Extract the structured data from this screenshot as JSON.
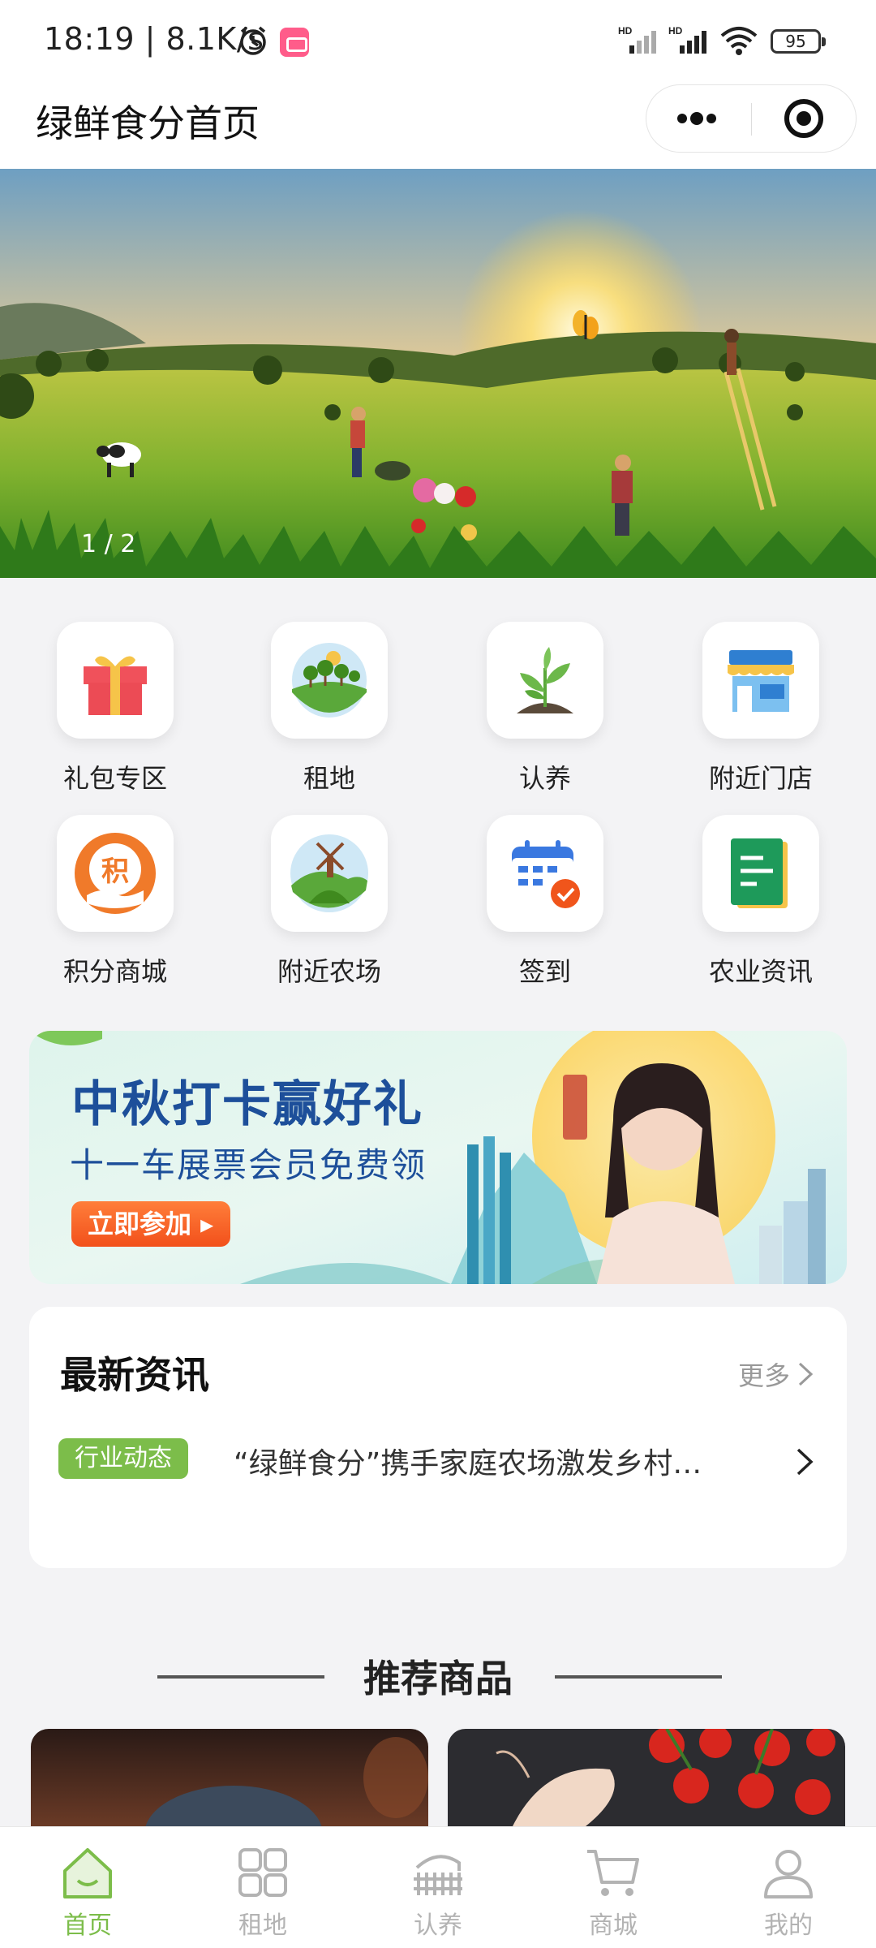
{
  "status_bar": {
    "time_speed": "18:19 | 8.1K/s",
    "battery": "95"
  },
  "header": {
    "title": "绿鲜食分首页"
  },
  "banner": {
    "counter": "1 / 2"
  },
  "menu": {
    "items": [
      {
        "label": "礼包专区",
        "icon": "gift-icon"
      },
      {
        "label": "租地",
        "icon": "land-icon"
      },
      {
        "label": "认养",
        "icon": "sprout-icon"
      },
      {
        "label": "附近门店",
        "icon": "store-icon"
      },
      {
        "label": "积分商城",
        "icon": "points-mall-icon"
      },
      {
        "label": "附近农场",
        "icon": "farm-icon"
      },
      {
        "label": "签到",
        "icon": "calendar-check-icon"
      },
      {
        "label": "农业资讯",
        "icon": "news-doc-icon"
      }
    ]
  },
  "promo": {
    "headline": "中秋打卡赢好礼",
    "subline": "十一车展票会员免费领",
    "button": "立即参加 ▸"
  },
  "news": {
    "title": "最新资讯",
    "more": "更多",
    "tag": "行业动态",
    "headline": "“绿鲜食分”携手家庭农场激发乡村…"
  },
  "recommended": {
    "title": "推荐商品"
  },
  "tabbar": {
    "tabs": [
      {
        "label": "首页",
        "icon": "home-icon",
        "active": true
      },
      {
        "label": "租地",
        "icon": "grid-icon",
        "active": false
      },
      {
        "label": "认养",
        "icon": "fence-icon",
        "active": false
      },
      {
        "label": "商城",
        "icon": "cart-icon",
        "active": false
      },
      {
        "label": "我的",
        "icon": "profile-icon",
        "active": false
      }
    ]
  },
  "colors": {
    "accent": "#7cbd4a",
    "promo_text": "#1d4f9a",
    "tab_inactive": "#b3b3b3"
  }
}
